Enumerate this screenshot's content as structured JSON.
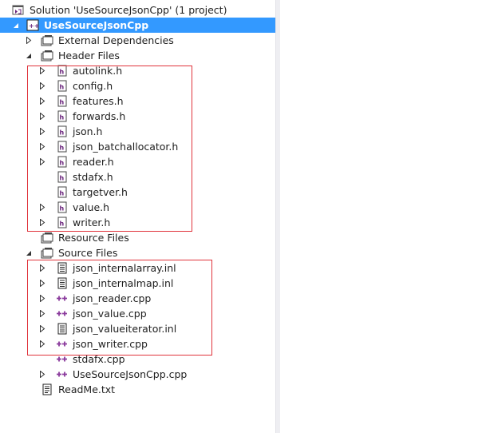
{
  "solution_explorer": {
    "solution": {
      "label": "Solution 'UseSourceJsonCpp' (1 project)",
      "icon": "solution-icon"
    },
    "project": {
      "label": "UseSourceJsonCpp",
      "icon": "cpp-project-icon",
      "expanded": true,
      "selected": true
    },
    "external_dependencies": {
      "label": "External Dependencies",
      "icon": "filter-folder-icon",
      "expanded": false
    },
    "header_files": {
      "label": "Header Files",
      "icon": "filter-folder-icon",
      "expanded": true,
      "items": [
        {
          "label": "autolink.h",
          "icon": "header-file-icon",
          "expandable": true
        },
        {
          "label": "config.h",
          "icon": "header-file-icon",
          "expandable": true
        },
        {
          "label": "features.h",
          "icon": "header-file-icon",
          "expandable": true
        },
        {
          "label": "forwards.h",
          "icon": "header-file-icon",
          "expandable": true
        },
        {
          "label": "json.h",
          "icon": "header-file-icon",
          "expandable": true
        },
        {
          "label": "json_batchallocator.h",
          "icon": "header-file-icon",
          "expandable": true
        },
        {
          "label": "reader.h",
          "icon": "header-file-icon",
          "expandable": true
        },
        {
          "label": "stdafx.h",
          "icon": "header-file-icon",
          "expandable": false
        },
        {
          "label": "targetver.h",
          "icon": "header-file-icon",
          "expandable": false
        },
        {
          "label": "value.h",
          "icon": "header-file-icon",
          "expandable": true
        },
        {
          "label": "writer.h",
          "icon": "header-file-icon",
          "expandable": true
        }
      ]
    },
    "resource_files": {
      "label": "Resource Files",
      "icon": "filter-folder-icon",
      "expanded": false
    },
    "source_files": {
      "label": "Source Files",
      "icon": "filter-folder-icon",
      "expanded": true,
      "items": [
        {
          "label": "json_internalarray.inl",
          "icon": "inline-file-icon",
          "expandable": true
        },
        {
          "label": "json_internalmap.inl",
          "icon": "inline-file-icon",
          "expandable": true
        },
        {
          "label": "json_reader.cpp",
          "icon": "cpp-file-icon",
          "expandable": true
        },
        {
          "label": "json_value.cpp",
          "icon": "cpp-file-icon",
          "expandable": true
        },
        {
          "label": "json_valueiterator.inl",
          "icon": "inline-file-icon",
          "expandable": true
        },
        {
          "label": "json_writer.cpp",
          "icon": "cpp-file-icon",
          "expandable": true
        },
        {
          "label": "stdafx.cpp",
          "icon": "cpp-file-icon",
          "expandable": false
        },
        {
          "label": "UseSourceJsonCpp.cpp",
          "icon": "cpp-file-icon",
          "expandable": true
        }
      ]
    },
    "readme": {
      "label": "ReadMe.txt",
      "icon": "text-file-icon"
    }
  },
  "colors": {
    "selection": "#3399ff",
    "highlight_box": "#e0343c",
    "cpp_icon": "#8a3a9c"
  }
}
